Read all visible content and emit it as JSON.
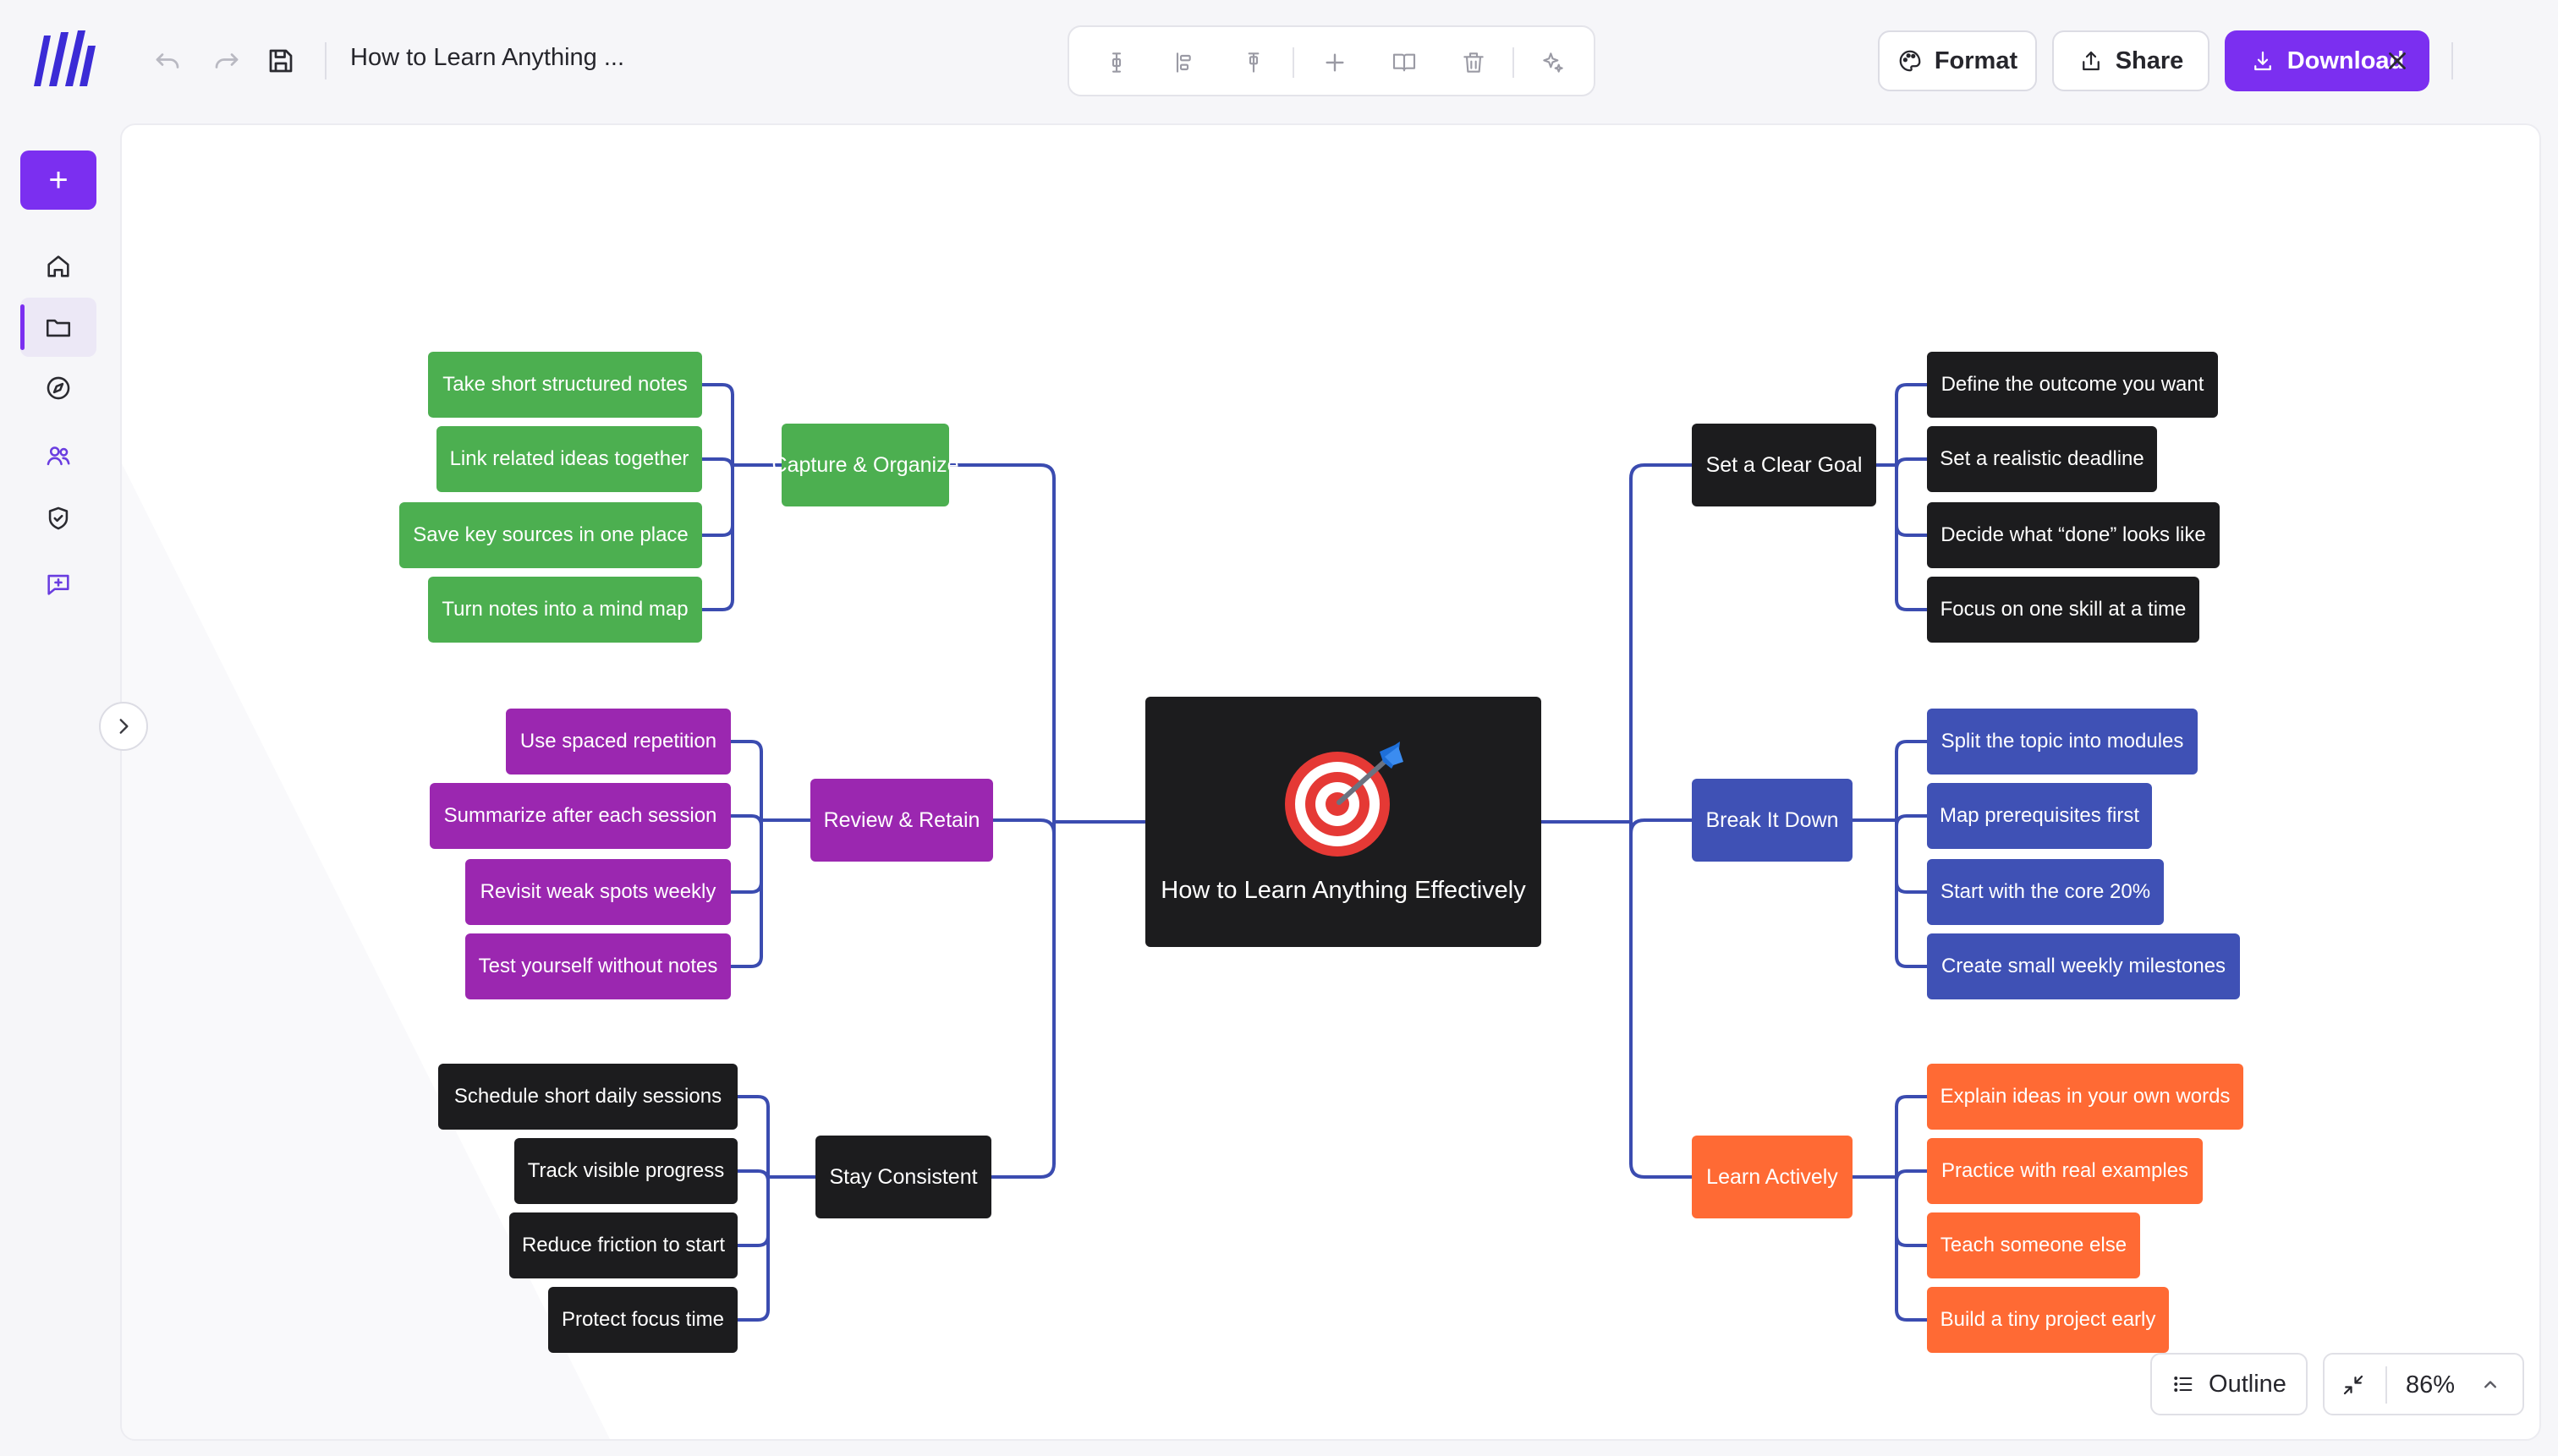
{
  "header": {
    "doc_title": "How to Learn Anything ...",
    "format_label": "Format",
    "share_label": "Share",
    "download_label": "Download"
  },
  "colors": {
    "accent": "#7b2ff0",
    "connector": "#3b4cb0",
    "green": "#4caf50",
    "purple": "#9b27b0",
    "black": "#1c1c1e",
    "blue": "#3f51b5",
    "orange": "#ff6a34"
  },
  "mindmap": {
    "root": "How to Learn Anything Effectively",
    "branches": [
      {
        "label": "Capture & Organize",
        "color": "green",
        "children": [
          "Take short structured notes",
          "Link related ideas together",
          "Save key sources in one place",
          "Turn notes into a mind map"
        ]
      },
      {
        "label": "Review & Retain",
        "color": "purple",
        "children": [
          "Use spaced repetition",
          "Summarize after each session",
          "Revisit weak spots weekly",
          "Test yourself without notes"
        ]
      },
      {
        "label": "Stay Consistent",
        "color": "black",
        "children": [
          "Schedule short daily sessions",
          "Track visible progress",
          "Reduce friction to start",
          "Protect focus time"
        ]
      },
      {
        "label": "Set a Clear Goal",
        "color": "black",
        "children": [
          "Define the outcome you want",
          "Set a realistic deadline",
          "Decide what “done” looks like",
          "Focus on one skill at a time"
        ]
      },
      {
        "label": "Break It Down",
        "color": "blue",
        "children": [
          "Split the topic into modules",
          "Map prerequisites first",
          "Start with the core 20%",
          "Create small weekly milestones"
        ]
      },
      {
        "label": "Learn Actively",
        "color": "orange",
        "children": [
          "Explain ideas in your own words",
          "Practice with real examples",
          "Teach someone else",
          "Build a tiny project early"
        ]
      }
    ]
  },
  "footer": {
    "outline_label": "Outline",
    "zoom": "86%"
  }
}
